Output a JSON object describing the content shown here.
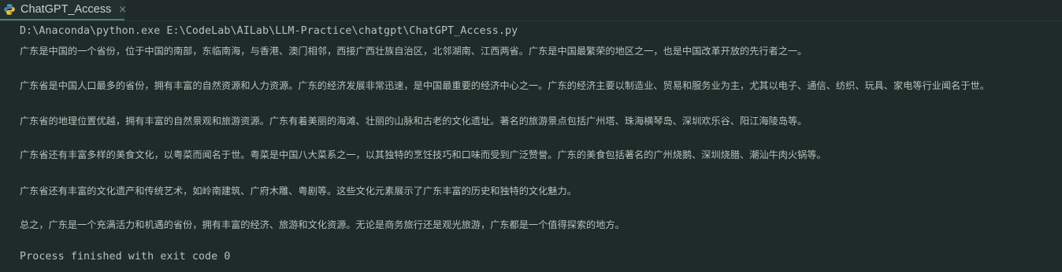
{
  "tab": {
    "icon": "python-icon",
    "title": "ChatGPT_Access",
    "close": "×"
  },
  "console": {
    "command": "D:\\Anaconda\\python.exe E:\\CodeLab\\AILab\\LLM-Practice\\chatgpt\\ChatGPT_Access.py",
    "paragraphs": [
      "广东是中国的一个省份，位于中国的南部，东临南海，与香港、澳门相邻，西接广西壮族自治区，北邻湖南、江西两省。广东是中国最繁荣的地区之一，也是中国改革开放的先行者之一。",
      "广东省是中国人口最多的省份，拥有丰富的自然资源和人力资源。广东的经济发展非常迅速，是中国最重要的经济中心之一。广东的经济主要以制造业、贸易和服务业为主，尤其以电子、通信、纺织、玩具、家电等行业闻名于世。",
      "广东省的地理位置优越，拥有丰富的自然景观和旅游资源。广东有着美丽的海滩、壮丽的山脉和古老的文化遗址。著名的旅游景点包括广州塔、珠海横琴岛、深圳欢乐谷、阳江海陵岛等。",
      "广东省还有丰富多样的美食文化，以粤菜而闻名于世。粤菜是中国八大菜系之一，以其独特的烹饪技巧和口味而受到广泛赞誉。广东的美食包括著名的广州烧鹅、深圳烧腊、潮汕牛肉火锅等。",
      "广东省还有丰富的文化遗产和传统艺术，如岭南建筑、广府木雕、粤剧等。这些文化元素展示了广东丰富的历史和独特的文化魅力。",
      "总之，广东是一个充满活力和机遇的省份，拥有丰富的经济、旅游和文化资源。无论是商务旅行还是观光旅游，广东都是一个值得探索的地方。"
    ],
    "exit_message": "Process finished with exit code 0"
  }
}
